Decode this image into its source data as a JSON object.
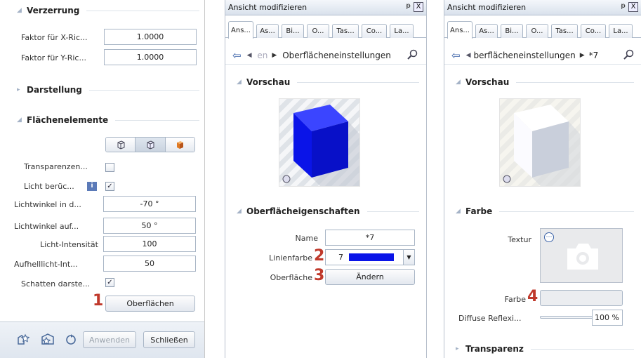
{
  "left": {
    "verzerrung": {
      "title": "Verzerrung",
      "rows": [
        {
          "label": "Faktor für X-Ric...",
          "value": "1.0000"
        },
        {
          "label": "Faktor für Y-Ric...",
          "value": "1.0000"
        }
      ]
    },
    "darstellung": {
      "title": "Darstellung"
    },
    "flaechen": {
      "title": "Flächenelemente",
      "transparenz_label": "Transparenzen...",
      "licht_label": "Licht berüc...",
      "rows": [
        {
          "label": "Lichtwinkel in d...",
          "value": "-70 °"
        },
        {
          "label": "Lichtwinkel auf...",
          "value": "50 °"
        },
        {
          "label": "Licht-Intensität",
          "value": "100"
        },
        {
          "label": "Aufhelllicht-Int...",
          "value": "50"
        }
      ],
      "schatten_label": "Schatten darste...",
      "oberflaechen_button": "Oberflächen"
    },
    "bottom": {
      "anwenden": "Anwenden",
      "schliessen": "Schließen"
    }
  },
  "mid": {
    "title": "Ansicht modifizieren",
    "pin": "ᵽ",
    "close": "X",
    "tabs": [
      "Ans...",
      "As...",
      "Bi...",
      "O...",
      "Tas...",
      "Co...",
      "La..."
    ],
    "nav": {
      "crumb": " en",
      "title": "Oberflächeneinstellungen"
    },
    "vorschau": "Vorschau",
    "props": "Oberflächeigenschaften",
    "name_label": "Name",
    "name_value": "*7",
    "linienfarbe_label": "Linienfarbe",
    "linienfarbe_value": "7",
    "oberflaeche_label": "Oberfläche",
    "aendern": "Ändern",
    "cube_color": "#0a14e8"
  },
  "right": {
    "title": "Ansicht modifizieren",
    "pin": "ᵽ",
    "close": "X",
    "tabs": [
      "Ans...",
      "As...",
      "Bi...",
      "O...",
      "Tas...",
      "Co...",
      "La..."
    ],
    "nav": {
      "title": "berflächeneinstellungen",
      "crumb": "*7"
    },
    "vorschau": "Vorschau",
    "farbe_section": "Farbe",
    "textur_label": "Textur",
    "farbe_label": "Farbe",
    "diffuse_label": "Diffuse Reflexi...",
    "diffuse_value": "100 %",
    "transparenz": "Transparenz"
  },
  "markers": [
    "1",
    "2",
    "3",
    "4"
  ]
}
